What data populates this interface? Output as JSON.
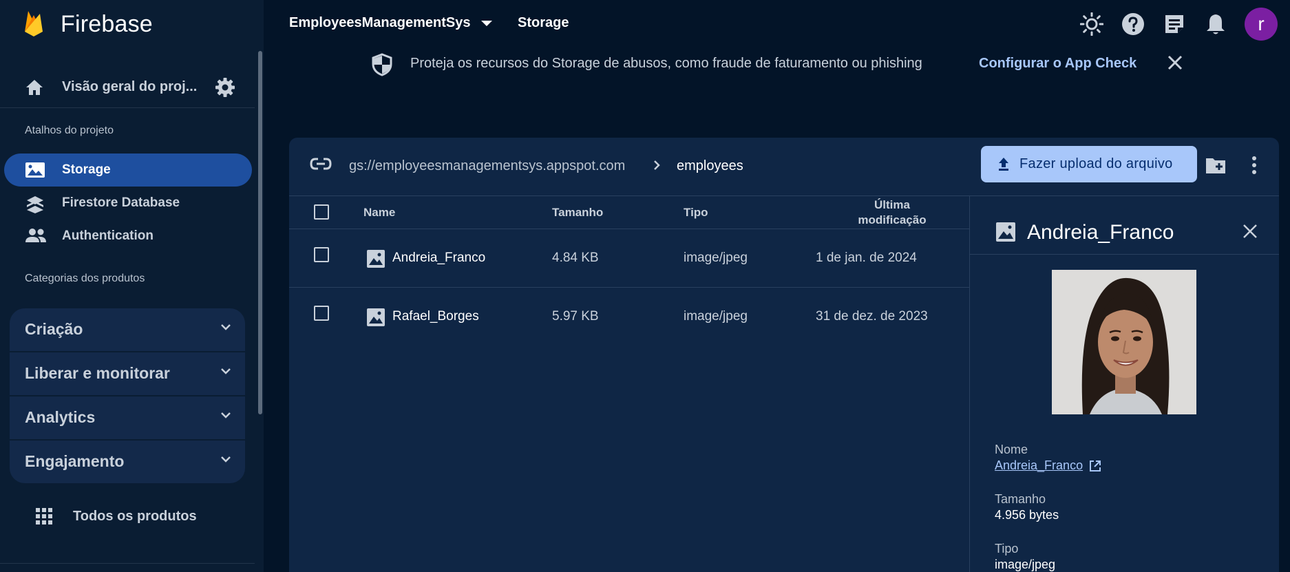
{
  "app": {
    "title": "Firebase"
  },
  "header": {
    "project_name": "EmployeesManagementSys",
    "section": "Storage",
    "avatar_letter": "r",
    "icons": [
      "theme-icon",
      "help-icon",
      "release-notes-icon",
      "notifications-icon"
    ]
  },
  "sidebar": {
    "overview_label": "Visão geral do proj...",
    "shortcuts_title": "Atalhos do projeto",
    "shortcuts": [
      {
        "label": "Storage",
        "icon": "image-icon",
        "active": true
      },
      {
        "label": "Firestore Database",
        "icon": "firestore-icon",
        "active": false
      },
      {
        "label": "Authentication",
        "icon": "people-icon",
        "active": false
      }
    ],
    "categories_title": "Categorias dos produtos",
    "categories": [
      {
        "label": "Criação"
      },
      {
        "label": "Liberar e monitorar"
      },
      {
        "label": "Analytics"
      },
      {
        "label": "Engajamento"
      }
    ],
    "all_products_label": "Todos os produtos"
  },
  "banner": {
    "text": "Proteja os recursos do Storage de abusos, como fraude de faturamento ou phishing",
    "link": "Configurar o App Check"
  },
  "storage": {
    "bucket": "gs://employeesmanagementsys.appspot.com",
    "folder": "employees",
    "upload_label": "Fazer upload do arquivo",
    "columns": {
      "name": "Name",
      "size": "Tamanho",
      "type": "Tipo",
      "modified_line1": "Última",
      "modified_line2": "modificação"
    },
    "files": [
      {
        "name": "Andreia_Franco",
        "size": "4.84 KB",
        "type": "image/jpeg",
        "modified": "1 de jan. de 2024"
      },
      {
        "name": "Rafael_Borges",
        "size": "5.97 KB",
        "type": "image/jpeg",
        "modified": "31 de dez. de 2023"
      }
    ]
  },
  "details": {
    "title": "Andreia_Franco",
    "name_label": "Nome",
    "name_value": "Andreia_Franco",
    "size_label": "Tamanho",
    "size_value": "4.956 bytes",
    "type_label": "Tipo",
    "type_value": "image/jpeg"
  },
  "colors": {
    "background": "#031428",
    "sidebar": "#0a1d33",
    "active_nav": "#1e4f9f",
    "accent": "#a8c7fa",
    "panel": "#0f2645"
  }
}
